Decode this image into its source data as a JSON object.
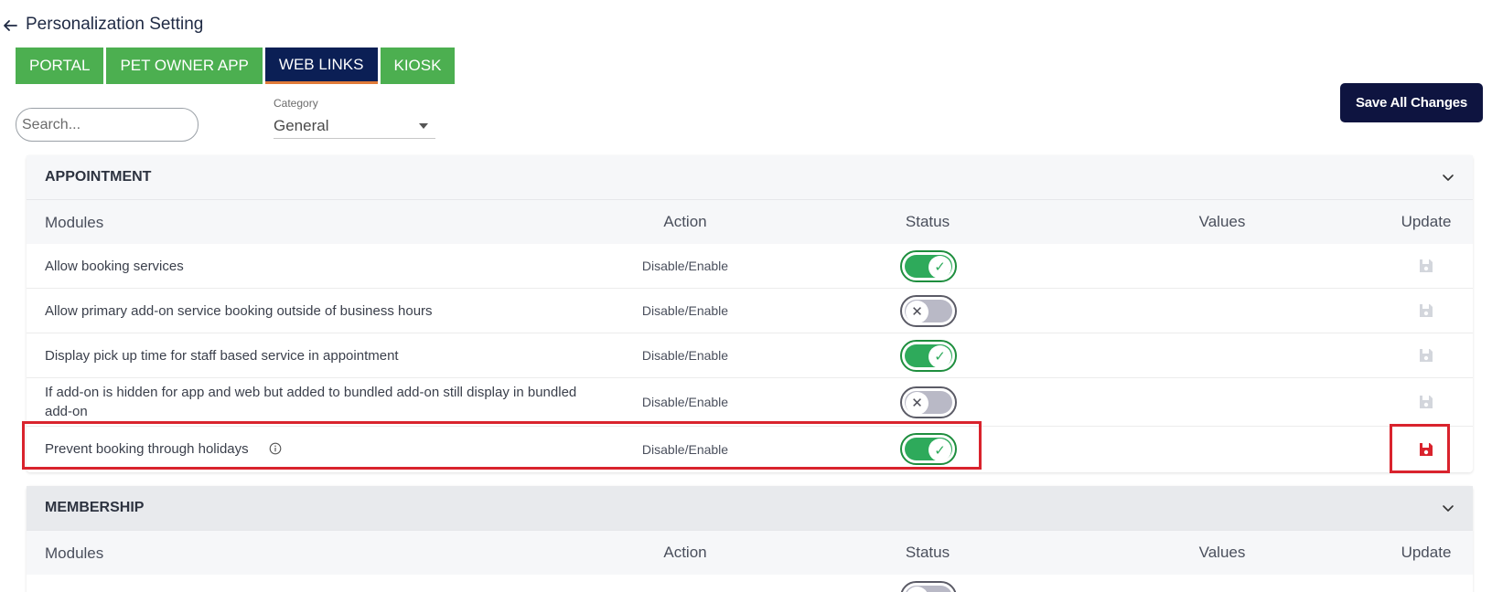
{
  "header": {
    "title": "Personalization Setting"
  },
  "tabs": [
    {
      "label": "PORTAL",
      "active": false
    },
    {
      "label": "PET OWNER APP",
      "active": false
    },
    {
      "label": "WEB LINKS",
      "active": true
    },
    {
      "label": "KIOSK",
      "active": false
    }
  ],
  "filters": {
    "search_placeholder": "Search...",
    "category_label": "Category",
    "category_value": "General"
  },
  "toolbar": {
    "save_all_label": "Save All Changes"
  },
  "columns": {
    "modules": "Modules",
    "action": "Action",
    "status": "Status",
    "values": "Values",
    "update": "Update"
  },
  "sections": [
    {
      "title": "APPOINTMENT",
      "rows": [
        {
          "module": "Allow booking services",
          "action": "Disable/Enable",
          "status": "on",
          "value": ""
        },
        {
          "module": "Allow primary add-on service booking outside of business hours",
          "action": "Disable/Enable",
          "status": "off",
          "value": ""
        },
        {
          "module": "Display pick up time for staff based service in appointment",
          "action": "Disable/Enable",
          "status": "on",
          "value": ""
        },
        {
          "module": "If add-on is hidden for app and web but added to bundled add-on still display in bundled add-on",
          "action": "Disable/Enable",
          "status": "off",
          "value": ""
        },
        {
          "module": "Prevent booking through holidays",
          "action": "Disable/Enable",
          "status": "on",
          "value": "",
          "has_info": true,
          "highlighted": true
        }
      ]
    },
    {
      "title": "MEMBERSHIP",
      "rows": []
    }
  ],
  "colors": {
    "tab_green": "#4caf50",
    "tab_active": "#0b1f55",
    "tab_active_underline": "#e07b39",
    "save_button_bg": "#0e1440",
    "toggle_on": "#2eaa5b",
    "toggle_off": "#b9b9c6",
    "highlight": "#d9232d",
    "save_icon_default": "#d3d6dc",
    "save_icon_active": "#d9232d"
  },
  "icons": {
    "back": "arrow-left-icon",
    "chevron": "chevron-down-icon",
    "save": "floppy-disk-icon",
    "info": "info-circle-icon"
  }
}
